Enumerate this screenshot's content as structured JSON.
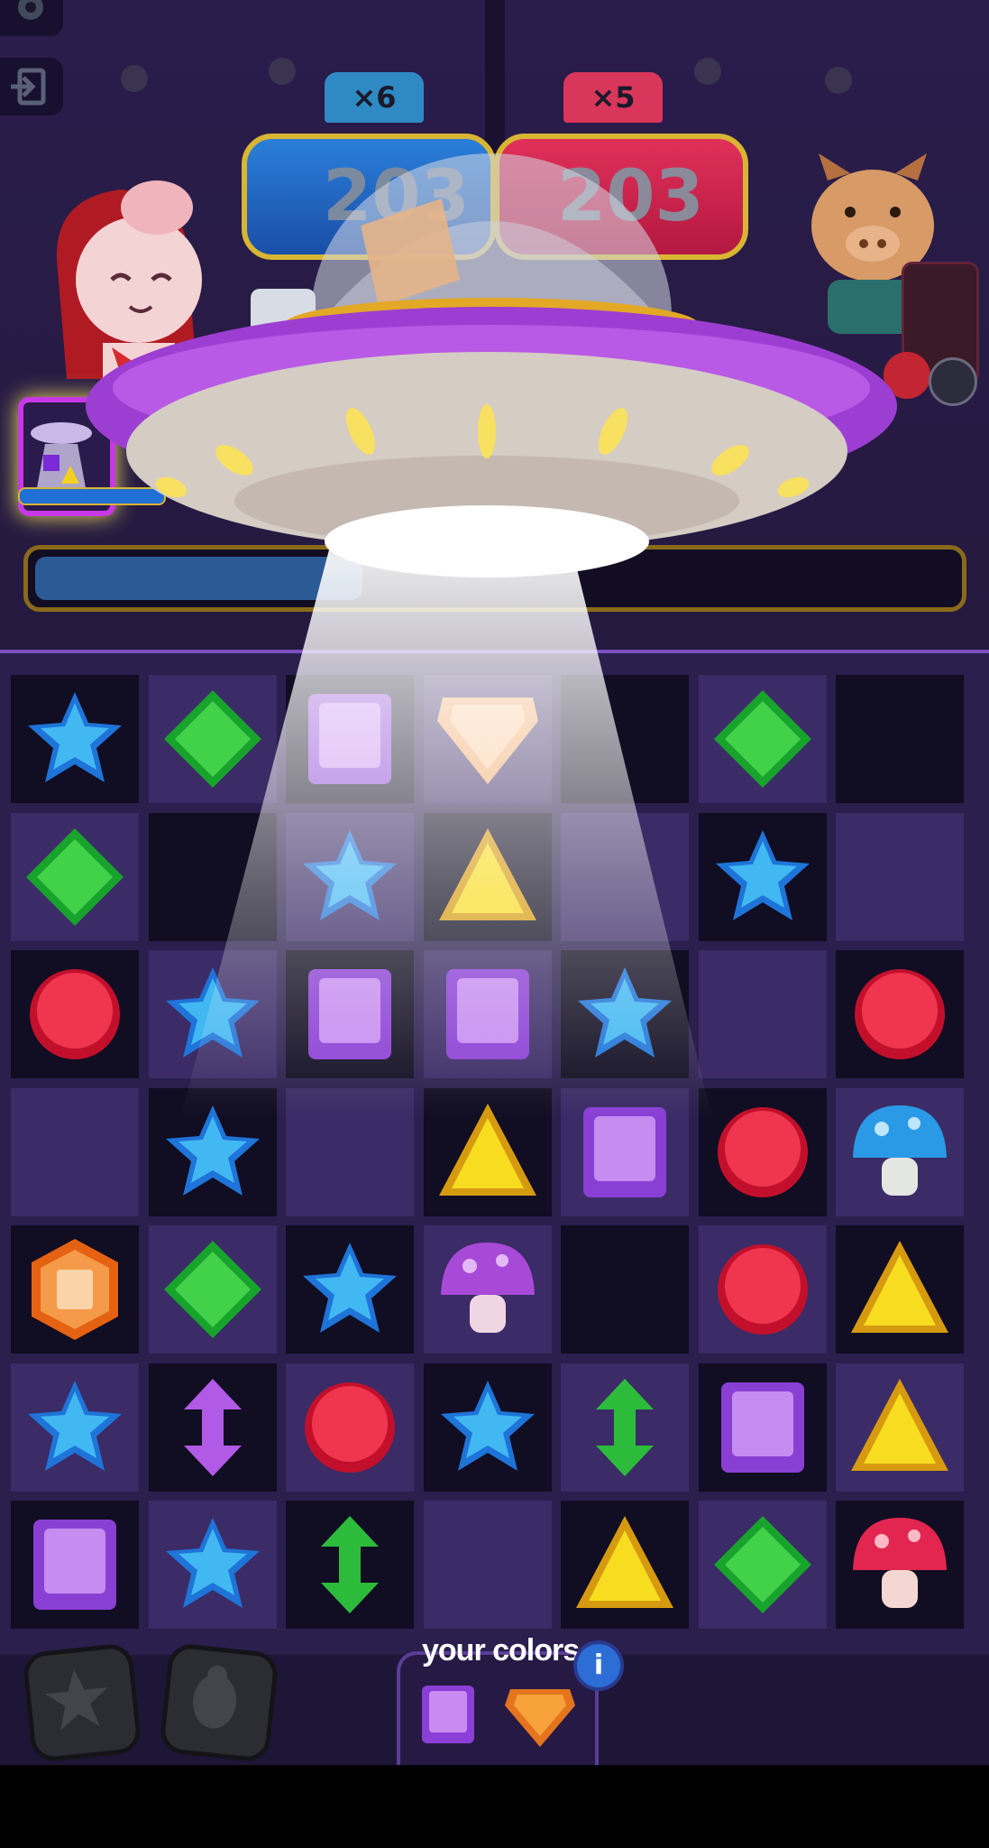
{
  "top_bar": {
    "settings_icon": "gear-icon",
    "exit_icon": "exit-icon"
  },
  "score": {
    "left_multiplier": "×6",
    "right_multiplier": "×5",
    "left_score": "203",
    "right_score": "203",
    "left_color": "#1f6fd6",
    "right_color": "#d8224e"
  },
  "powerup": {
    "icon": "ufo-powerup-icon",
    "charge_fraction": 1.0
  },
  "progress_bar": {
    "fill_fraction": 0.35,
    "color": "#2c6fc9"
  },
  "board": {
    "rows": 7,
    "cols": 7,
    "grid": [
      [
        "star",
        "diamond",
        "square",
        "orange-gem",
        "empty",
        "diamond",
        "empty"
      ],
      [
        "diamond",
        "empty",
        "star",
        "triangle",
        "empty",
        "star",
        "empty"
      ],
      [
        "circle",
        "star",
        "square",
        "square",
        "star",
        "empty",
        "circle"
      ],
      [
        "empty",
        "star",
        "empty",
        "triangle",
        "square",
        "circle",
        "mushroom-blue"
      ],
      [
        "bomb-orange",
        "diamond",
        "star",
        "mushroom-purple",
        "empty",
        "circle",
        "triangle"
      ],
      [
        "star",
        "arrow-purple",
        "circle",
        "star",
        "arrow-green",
        "square",
        "triangle"
      ],
      [
        "square",
        "star",
        "arrow-green",
        "empty",
        "triangle",
        "diamond",
        "mushroom-red"
      ]
    ]
  },
  "boosters": [
    {
      "name": "star-booster",
      "icon": "star-booster-icon"
    },
    {
      "name": "beetle-booster",
      "icon": "beetle-booster-icon"
    }
  ],
  "your_colors": {
    "label": "your colors",
    "info_icon": "info-icon",
    "info_text": "i",
    "colors": [
      "purple-square",
      "orange-gem"
    ]
  },
  "colors": {
    "accent_gold": "#d8b532",
    "board_bg": "#2a1f4d",
    "cell_dark": "#110d22",
    "cell_light": "#3b2b66"
  }
}
